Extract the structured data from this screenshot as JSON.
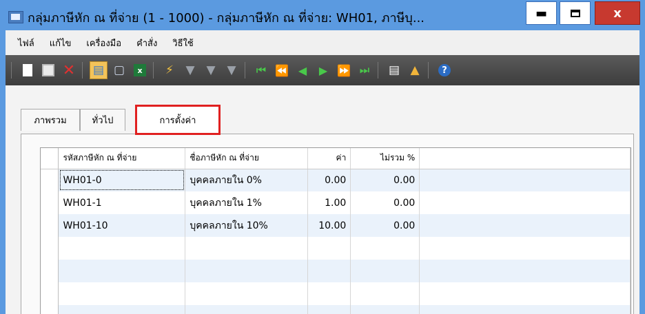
{
  "window": {
    "title": "กลุ่มภาษีหัก ณ ที่จ่าย (1 - 1000) - กลุ่มภาษีหัก ณ ที่จ่าย: WH01, ภาษีบุ...",
    "min_icon": "minimize-icon",
    "max_icon": "maximize-icon",
    "close_label": "x"
  },
  "menu": {
    "items": [
      "ไฟล์",
      "แก้ไข",
      "เครื่องมือ",
      "คำสั่ง",
      "วิธีใช้"
    ]
  },
  "toolbar": {
    "icons": [
      "new-icon",
      "save-icon",
      "delete-icon",
      "print-icon",
      "print-preview-icon",
      "excel-icon",
      "filter-by-selection-icon",
      "filter-by-grid-icon",
      "advanced-filter-icon",
      "remove-filter-icon",
      "first-record-icon",
      "previous-page-icon",
      "previous-record-icon",
      "next-record-icon",
      "next-page-icon",
      "last-record-icon",
      "document-handling-icon",
      "alert-icon",
      "help-icon"
    ],
    "help_label": "?",
    "excel_label": "x",
    "accent": "#f3c35a"
  },
  "tabs": [
    {
      "label": "ภาพรวม"
    },
    {
      "label": "ทั่วไป"
    },
    {
      "label": "การตั้งค่า",
      "active": true
    }
  ],
  "grid": {
    "columns": [
      "รหัสภาษีหัก ณ ที่จ่าย",
      "ชื่อภาษีหัก ณ ที่จ่าย",
      "ค่า",
      "ไม่รวม %"
    ],
    "rows": [
      {
        "code": "WH01-0",
        "name": "บุคคลภายใน 0%",
        "value": "0.00",
        "exclude": "0.00"
      },
      {
        "code": "WH01-1",
        "name": "บุคคลภายใน 1%",
        "value": "1.00",
        "exclude": "0.00"
      },
      {
        "code": "WH01-10",
        "name": "บุคคลภายใน 10%",
        "value": "10.00",
        "exclude": "0.00"
      }
    ]
  },
  "colors": {
    "titlebar": "#5b9ae0",
    "close_button": "#c7392f",
    "highlight_box": "#e02020",
    "row_alt": "#eaf2fb"
  }
}
